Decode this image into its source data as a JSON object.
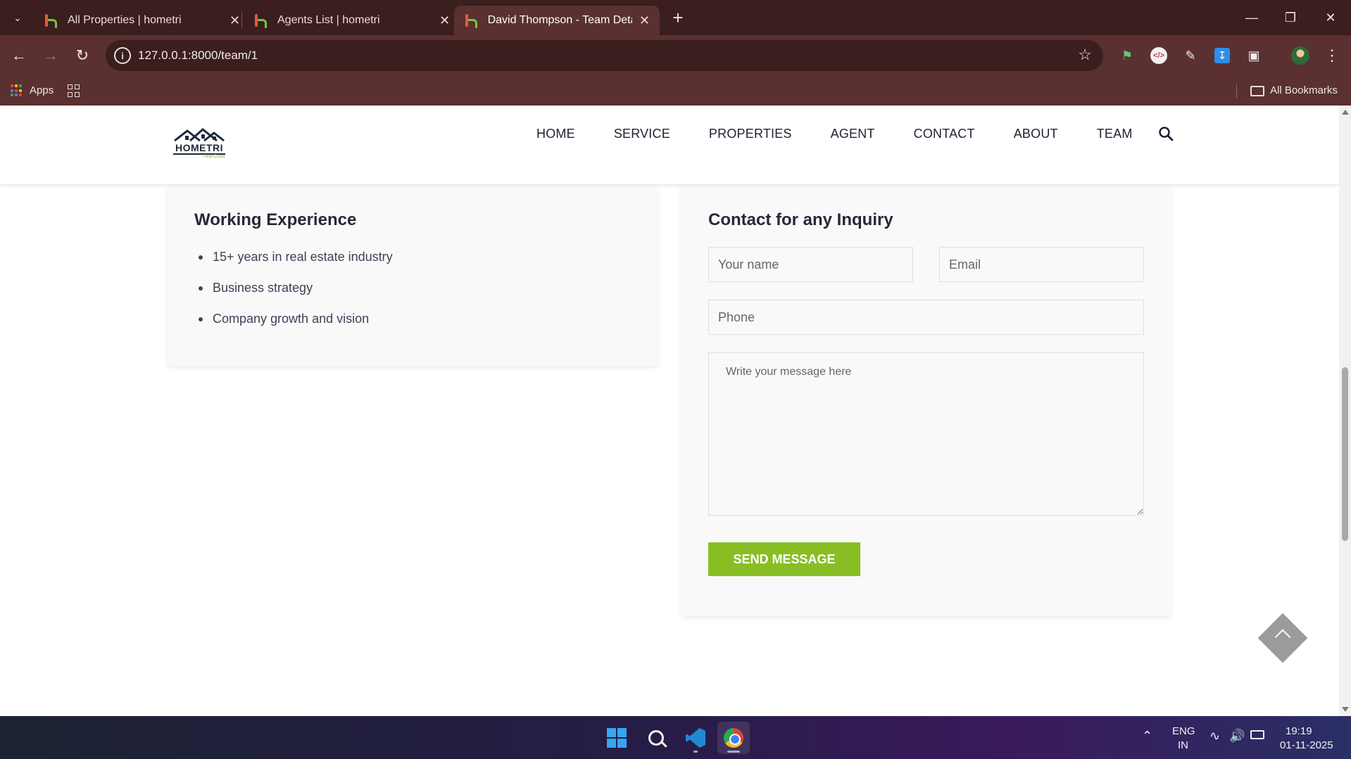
{
  "browser": {
    "tabs": [
      {
        "title": "All Properties | hometri",
        "active": false
      },
      {
        "title": "Agents List | hometri",
        "active": false
      },
      {
        "title": "David Thompson - Team Details",
        "active": true
      }
    ],
    "url": "127.0.0.1:8000/team/1",
    "bookmarks": {
      "apps_label": "Apps",
      "all_bookmarks_label": "All Bookmarks"
    }
  },
  "site": {
    "logo": {
      "brand": "HOMETRI",
      "tagline": "Real Estate"
    },
    "nav": [
      "HOME",
      "SERVICE",
      "PROPERTIES",
      "AGENT",
      "CONTACT",
      "ABOUT",
      "TEAM"
    ],
    "experience": {
      "title": "Working Experience",
      "items": [
        "15+ years in real estate industry",
        "Business strategy",
        "Company growth and vision"
      ]
    },
    "inquiry": {
      "title": "Contact for any Inquiry",
      "name_placeholder": "Your name",
      "email_placeholder": "Email",
      "phone_placeholder": "Phone",
      "message_placeholder": "Write your message here",
      "submit_label": "SEND MESSAGE"
    }
  },
  "taskbar": {
    "lang_line1": "ENG",
    "lang_line2": "IN",
    "time": "19:19",
    "date": "01-11-2025"
  },
  "colors": {
    "accent_green": "#88be24",
    "chrome_frame": "#3b1e1e",
    "chrome_toolbar": "#5a3030"
  }
}
